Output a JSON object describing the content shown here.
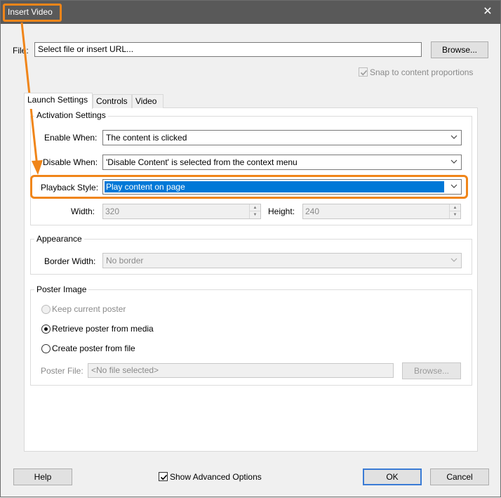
{
  "window": {
    "title": "Insert Video",
    "close_glyph": "✕"
  },
  "file": {
    "label": "File:",
    "value": "Select file or insert URL...",
    "browse_label": "Browse..."
  },
  "snap": {
    "label": "Snap to content proportions",
    "checked": true,
    "disabled": true
  },
  "tabs": [
    {
      "label": "Launch Settings",
      "active": true
    },
    {
      "label": "Controls",
      "active": false
    },
    {
      "label": "Video",
      "active": false
    }
  ],
  "activation": {
    "group_title": "Activation Settings",
    "enable_label": "Enable When:",
    "enable_value": "The content is clicked",
    "disable_label": "Disable When:",
    "disable_value": "'Disable Content' is selected from the context menu",
    "playback_label": "Playback Style:",
    "playback_value": "Play content on page",
    "width_label": "Width:",
    "width_value": "320",
    "height_label": "Height:",
    "height_value": "240"
  },
  "appearance": {
    "group_title": "Appearance",
    "border_label": "Border Width:",
    "border_value": "No border"
  },
  "poster": {
    "group_title": "Poster Image",
    "keep_label": "Keep current poster",
    "retrieve_label": "Retrieve poster from media",
    "create_label": "Create poster from file",
    "file_label": "Poster File:",
    "file_value": "<No file selected>",
    "browse_label": "Browse...",
    "selected": "retrieve"
  },
  "footer": {
    "help_label": "Help",
    "advanced_label": "Show Advanced Options",
    "advanced_checked": true,
    "ok_label": "OK",
    "cancel_label": "Cancel"
  },
  "colors": {
    "annotation": "#f08519",
    "selection": "#0078d7",
    "titlebar": "#595959"
  },
  "icons": {
    "close": "close-icon",
    "dropdown": "chevron-down-icon",
    "spin": "spinner-arrows-icon",
    "annotation_arrow": "orange-arrow-annotation"
  }
}
